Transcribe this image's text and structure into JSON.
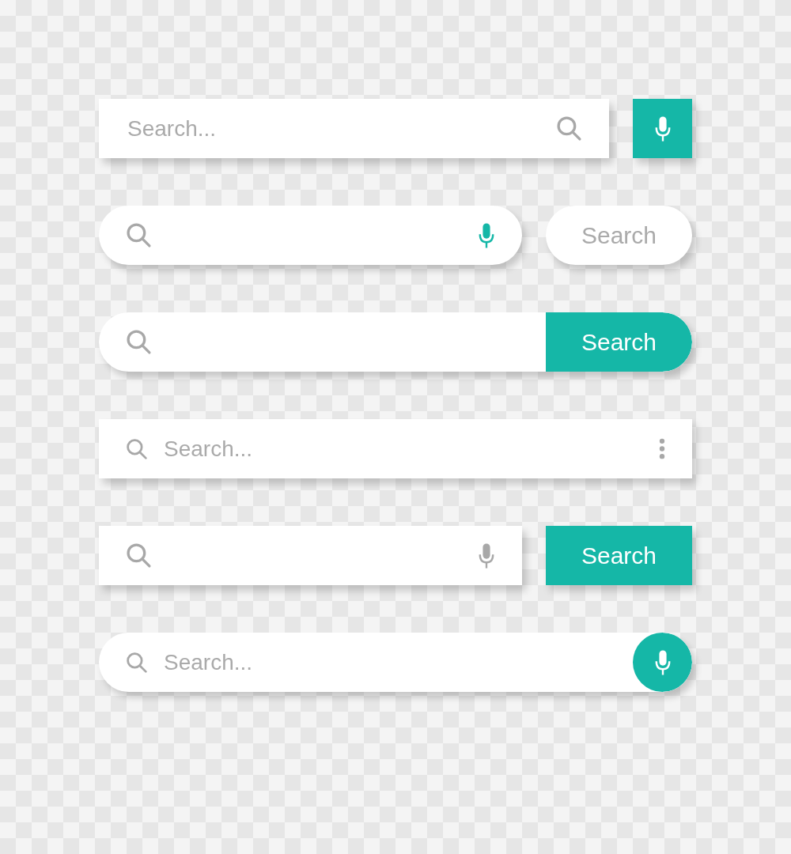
{
  "search_bars": [
    {
      "kind": "square-icon-right-mic-tile",
      "placeholder": "Search..."
    },
    {
      "kind": "round-mic-pill-button",
      "button": "Search"
    },
    {
      "kind": "round-attached-button",
      "button": "Search"
    },
    {
      "kind": "square-menu",
      "placeholder": "Search..."
    },
    {
      "kind": "square-mic-tile-button",
      "button": "Search"
    },
    {
      "kind": "round-mic-circle",
      "placeholder": "Search..."
    }
  ]
}
